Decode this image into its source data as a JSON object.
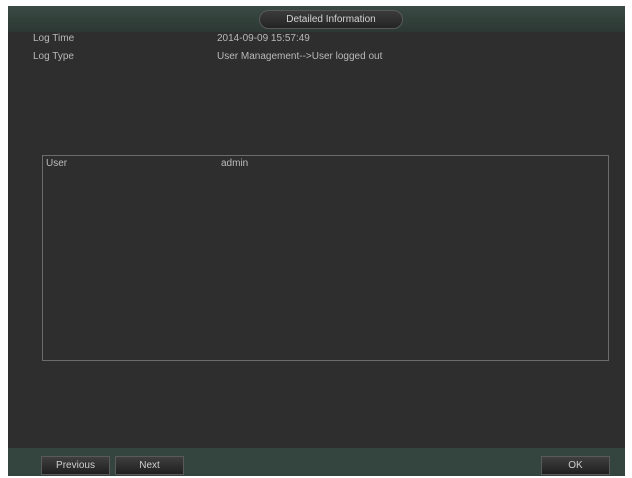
{
  "dialog": {
    "title": "Detailed Information"
  },
  "info": [
    {
      "label": "Log Time",
      "value": "2014-09-09 15:57:49"
    },
    {
      "label": "Log Type",
      "value": "User Management-->User logged out"
    }
  ],
  "details": [
    {
      "label": "User",
      "value": "admin"
    }
  ],
  "buttons": {
    "previous": "Previous",
    "next": "Next",
    "ok": "OK"
  }
}
